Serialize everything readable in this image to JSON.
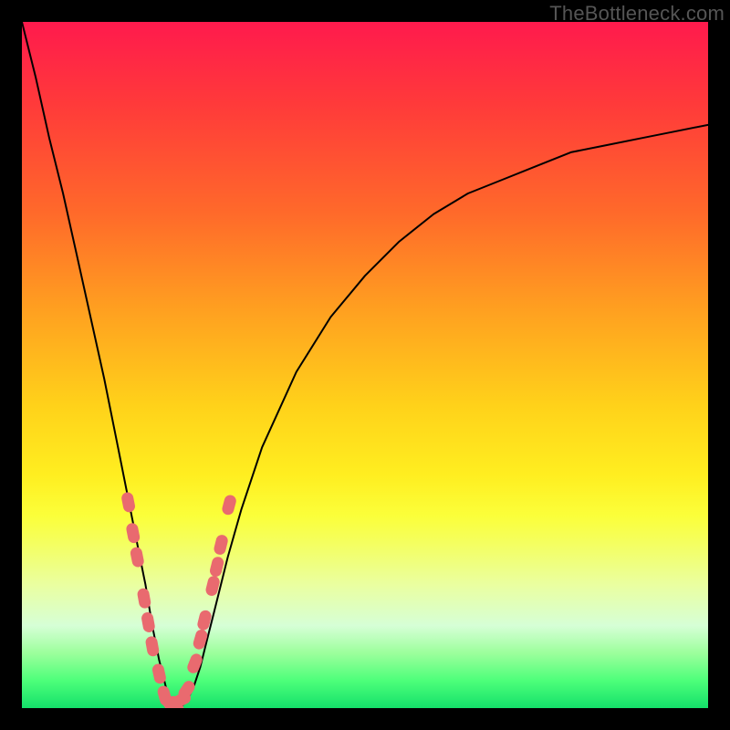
{
  "watermark": "TheBottleneck.com",
  "colors": {
    "frame": "#000000",
    "curve": "#000000",
    "marker": "#e96a6f",
    "gradient_top": "#ff1a4d",
    "gradient_bottom": "#14e06a"
  },
  "chart_data": {
    "type": "line",
    "title": "",
    "xlabel": "",
    "ylabel": "",
    "xlim": [
      0,
      100
    ],
    "ylim": [
      0,
      100
    ],
    "grid": false,
    "legend": "none",
    "series": [
      {
        "name": "bottleneck-curve",
        "x": [
          0,
          2,
          4,
          6,
          8,
          10,
          12,
          14,
          15,
          16,
          17,
          18,
          19,
          20,
          21,
          22,
          23,
          24,
          25,
          26,
          27,
          28,
          30,
          32,
          35,
          40,
          45,
          50,
          55,
          60,
          65,
          70,
          75,
          80,
          85,
          90,
          95,
          100
        ],
        "y": [
          100,
          92,
          83,
          75,
          66,
          57,
          48,
          38,
          33,
          28,
          23,
          18,
          12,
          7,
          3,
          0,
          0,
          1,
          3,
          6,
          10,
          14,
          22,
          29,
          38,
          49,
          57,
          63,
          68,
          72,
          75,
          77,
          79,
          81,
          82,
          83,
          84,
          85
        ]
      }
    ],
    "annotations": [
      {
        "name": "left-branch-markers",
        "points": [
          {
            "x": 15.5,
            "y": 30
          },
          {
            "x": 16.2,
            "y": 25.5
          },
          {
            "x": 16.8,
            "y": 22
          },
          {
            "x": 17.8,
            "y": 16
          },
          {
            "x": 18.4,
            "y": 12.5
          },
          {
            "x": 19.0,
            "y": 9
          },
          {
            "x": 20.0,
            "y": 5
          }
        ]
      },
      {
        "name": "trough-markers",
        "points": [
          {
            "x": 20.8,
            "y": 1.8
          },
          {
            "x": 21.6,
            "y": 0.5
          },
          {
            "x": 22.4,
            "y": 0.4
          },
          {
            "x": 23.2,
            "y": 1.2
          },
          {
            "x": 24.0,
            "y": 2.6
          }
        ]
      },
      {
        "name": "right-branch-markers",
        "points": [
          {
            "x": 25.2,
            "y": 6.5
          },
          {
            "x": 26.0,
            "y": 10.0
          },
          {
            "x": 26.6,
            "y": 12.8
          },
          {
            "x": 27.8,
            "y": 17.8
          },
          {
            "x": 28.4,
            "y": 20.6
          },
          {
            "x": 29.0,
            "y": 23.8
          },
          {
            "x": 30.2,
            "y": 29.6
          }
        ]
      }
    ]
  }
}
